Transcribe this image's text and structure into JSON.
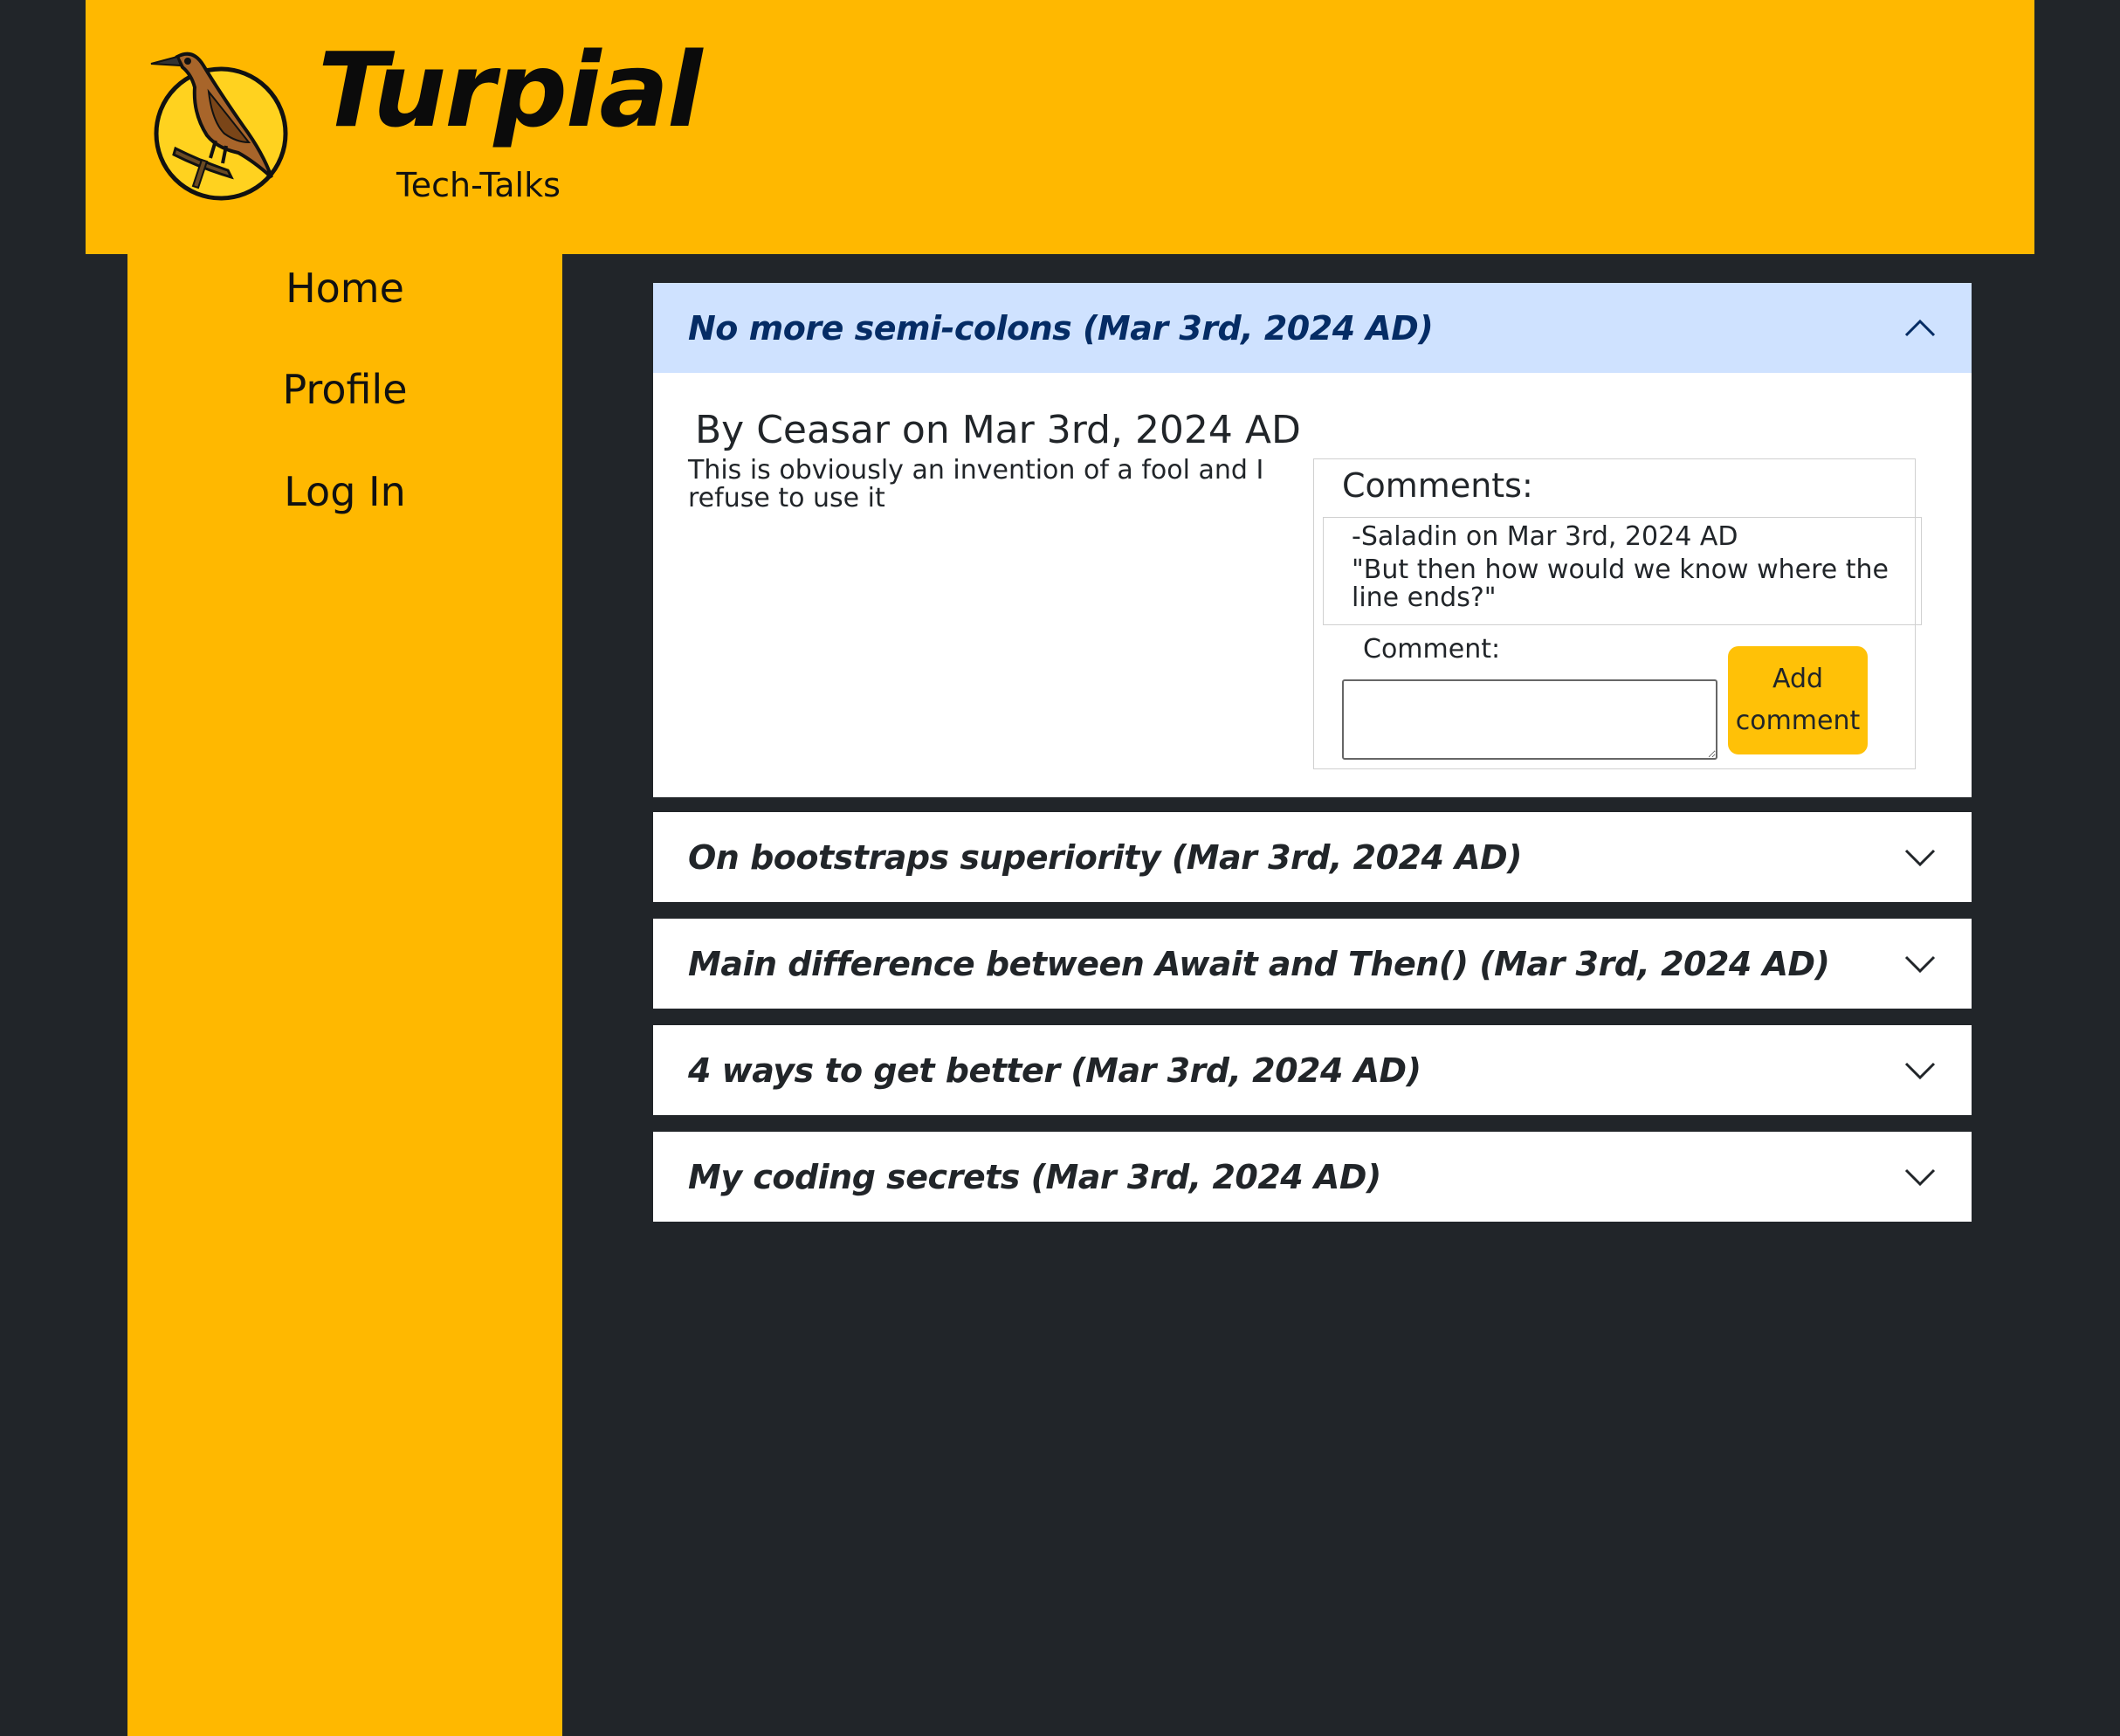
{
  "brand": {
    "title": "Turpial",
    "subtitle": "Tech-Talks",
    "logo_icon": "turpial-bird-logo-icon"
  },
  "nav": {
    "items": [
      {
        "label": "Home"
      },
      {
        "label": "Profile"
      },
      {
        "label": "Log In"
      }
    ]
  },
  "posts": [
    {
      "title": "No more semi-colons (Mar 3rd, 2024 AD)",
      "expanded": true,
      "byline": "By Ceasar on Mar 3rd, 2024 AD",
      "body": "This is obviously an invention of a fool and I refuse to use it",
      "comments_heading": "Comments:",
      "comments": [
        {
          "author_line": "-Saladin on Mar 3rd, 2024 AD",
          "text": "\"But then how would we know where the line ends?\""
        }
      ],
      "comment_label": "Comment:",
      "comment_input_value": "",
      "add_comment_label": "Add comment"
    },
    {
      "title": "On bootstraps superiority (Mar 3rd, 2024 AD)",
      "expanded": false
    },
    {
      "title": "Main difference between Await and Then() (Mar 3rd, 2024 AD)",
      "expanded": false
    },
    {
      "title": "4 ways to get better (Mar 3rd, 2024 AD)",
      "expanded": false
    },
    {
      "title": "My coding secrets (Mar 3rd, 2024 AD)",
      "expanded": false
    }
  ],
  "colors": {
    "page_background": "#212529",
    "brand_yellow": "#FFB800",
    "button_yellow": "#FFC107",
    "accordion_open_header": "#CFE2FF",
    "accordion_open_title": "#052c65"
  }
}
